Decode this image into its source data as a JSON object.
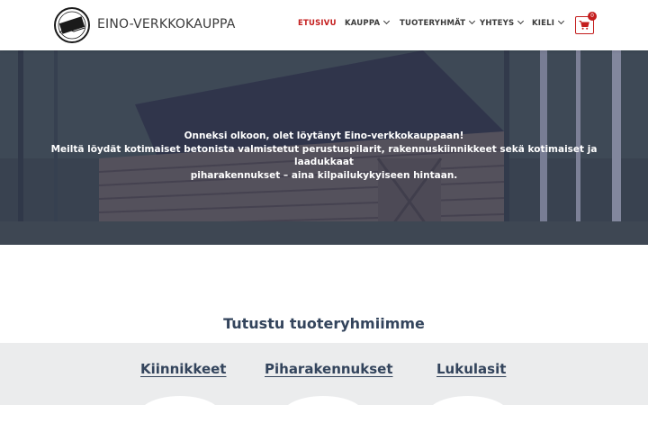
{
  "header": {
    "site_title": "EINO-VERKKOKAUPPA",
    "logo_text": "EINO",
    "nav": [
      {
        "label": "ETUSIVU",
        "active": true,
        "has_dropdown": false
      },
      {
        "label": "KAUPPA",
        "active": false,
        "has_dropdown": true
      },
      {
        "label": "TUOTERYHMÄT",
        "active": false,
        "has_dropdown": true
      },
      {
        "label": "YHTEYS",
        "active": false,
        "has_dropdown": true
      },
      {
        "label": "KIELI",
        "active": false,
        "has_dropdown": true
      }
    ],
    "cart_count": "0",
    "cart_icon": "shopping-cart-icon",
    "accent_color": "#c41e1e"
  },
  "hero": {
    "line1": "Onneksi olkoon, olet löytänyt Eino-verkkokauppaan!",
    "line2": "Meiltä löydät kotimaiset betonista valmistetut perustuspilarit, rakennuskiinnikkeet sekä kotimaiset ja laadukkaat",
    "line3": "piharakennukset – aina kilpailukykyiseen hintaan."
  },
  "products": {
    "title": "Tutustu tuoteryhmiimme",
    "categories": [
      {
        "label": "Kiinnikkeet"
      },
      {
        "label": "Piharakennukset"
      },
      {
        "label": "Lukulasit"
      }
    ]
  }
}
